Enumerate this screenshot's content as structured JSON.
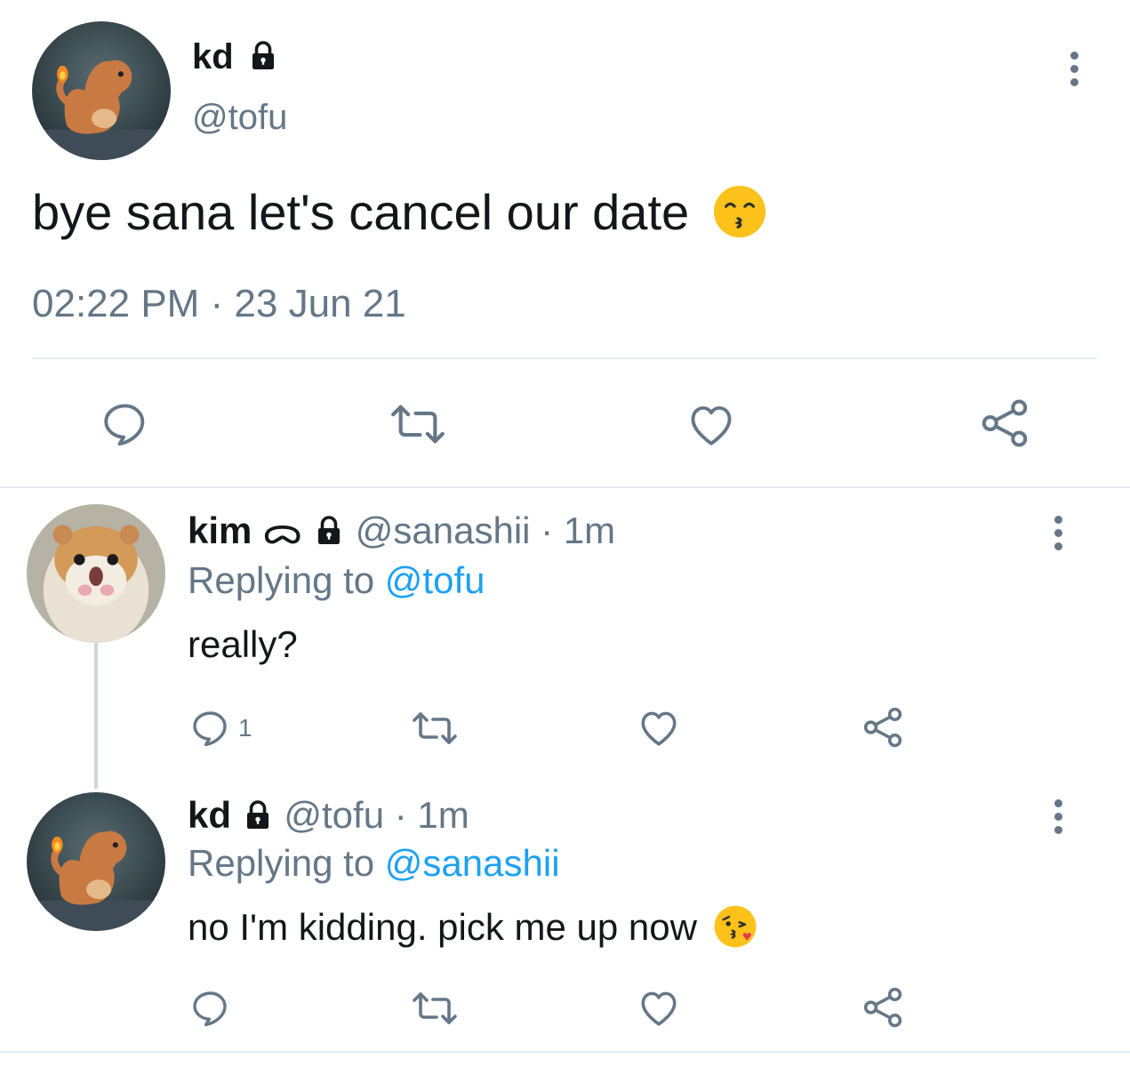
{
  "main_tweet": {
    "display_name": "kd",
    "handle": "@tofu",
    "text": "bye sana let's cancel our date",
    "emoji": "kissing-face-with-smiling-eyes",
    "timestamp": "02:22 PM · 23 Jun 21"
  },
  "replies": [
    {
      "display_name": "kim",
      "name_symbol": "ᯅ",
      "handle": "@sanashii",
      "age": "· 1m",
      "replying_label": "Replying to",
      "replying_to": "@tofu",
      "text": "really?",
      "reply_count": "1"
    },
    {
      "display_name": "kd",
      "handle": "@tofu",
      "age": "· 1m",
      "replying_label": "Replying to",
      "replying_to": "@sanashii",
      "text": "no I'm kidding. pick me up now",
      "emoji": "face-blowing-a-kiss",
      "reply_count": ""
    }
  ],
  "colors": {
    "text": "#14171a",
    "secondary": "#657786",
    "link": "#1da1f2",
    "divider": "#e6ecf0"
  },
  "icons": [
    "lock-icon",
    "more-options-icon",
    "reply-icon",
    "retweet-icon",
    "like-icon",
    "share-icon"
  ]
}
